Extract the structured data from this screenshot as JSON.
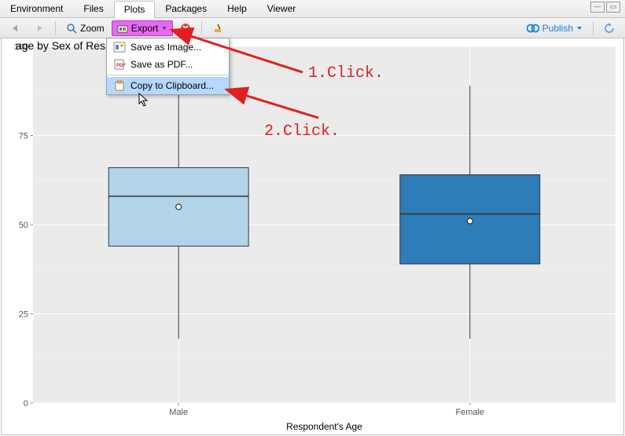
{
  "tabs": {
    "env": "Environment",
    "files": "Files",
    "plots": "Plots",
    "packages": "Packages",
    "help": "Help",
    "viewer": "Viewer"
  },
  "toolbar": {
    "zoom": "Zoom",
    "export": "Export",
    "publish": "Publish"
  },
  "export_menu": {
    "image": "Save as Image...",
    "pdf": "Save as PDF...",
    "clip": "Copy to Clipboard..."
  },
  "annotations": {
    "a1": "1.Click.",
    "a2": "2.Click."
  },
  "chart_data": {
    "type": "boxplot",
    "title": "age by Sex of Respondent",
    "xlabel": "Respondent's Age",
    "ylabel": "",
    "ylim": [
      0,
      100
    ],
    "yticks": [
      0,
      25,
      50,
      75,
      100
    ],
    "categories": [
      "Male",
      "Female"
    ],
    "series": [
      {
        "name": "Male",
        "fill": "#b1d4e8",
        "lower_whisker": 18,
        "q1": 44,
        "median": 58,
        "q3": 66,
        "upper_whisker": 89,
        "outlier": 55
      },
      {
        "name": "Female",
        "fill": "#2e7cb8",
        "lower_whisker": 18,
        "q1": 39,
        "median": 53,
        "q3": 64,
        "upper_whisker": 89,
        "outlier": 51
      }
    ]
  }
}
